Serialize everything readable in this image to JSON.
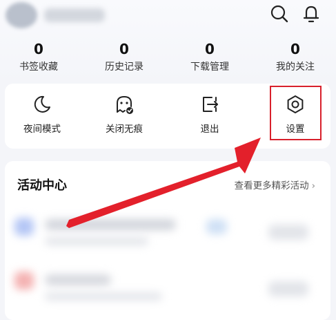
{
  "header": {
    "search_icon": "search-icon",
    "bell_icon": "bell-icon"
  },
  "stats": [
    {
      "count": "0",
      "label": "书签收藏"
    },
    {
      "count": "0",
      "label": "历史记录"
    },
    {
      "count": "0",
      "label": "下载管理"
    },
    {
      "count": "0",
      "label": "我的关注"
    }
  ],
  "tools": [
    {
      "label": "夜间模式",
      "icon": "moon-icon"
    },
    {
      "label": "关闭无痕",
      "icon": "ghost-icon"
    },
    {
      "label": "退出",
      "icon": "logout-icon"
    },
    {
      "label": "设置",
      "icon": "settings-icon"
    }
  ],
  "activity": {
    "title": "活动中心",
    "more": "查看更多精彩活动",
    "more_chevron": "›"
  },
  "colors": {
    "highlight": "#d8202b",
    "arrow": "#e3202b",
    "background": "#f4f5f9"
  }
}
